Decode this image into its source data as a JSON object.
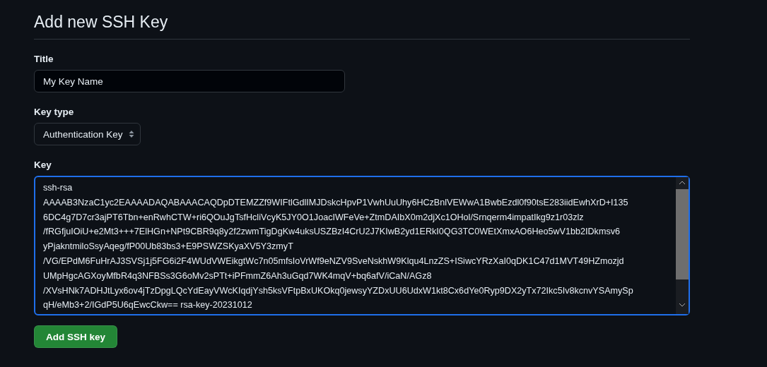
{
  "heading": "Add new SSH Key",
  "title_field": {
    "label": "Title",
    "value": "My Key Name"
  },
  "key_type": {
    "label": "Key type",
    "value": "Authentication Key"
  },
  "key_field": {
    "label": "Key",
    "focused": true,
    "lines": [
      "ssh-rsa",
      "AAAAB3NzaC1yc2EAAAADAQABAAACAQDpDTEMZZf9WIFtlGdlIMJDskcHpvP1VwhUuUhy6HCzBnlVEWwA1BwbEzdl0f90tsE283iidEwhXrD+I135",
      "6DC4g7D7cr3ajPT6Tbn+enRwhCTW+ri6QOuJgTsfHcliVcyK5JY0O1JoacIWFeVe+ZtmDAIbX0m2djXc1OHol/Srnqerm4impatIkg9z1r03zlz",
      "/fRGfjuIOiU+e2Mt3+++7ElHGn+NPt9CBR9q8y2f2zwmTigDgKw4uksUSZBzI4CrU2J7KIwB2yd1ERkI0QG3TC0WEtXmxAO6Heo5wV1bb2IDkmsv6",
      "yPjakntmiloSsyAqeg/fP00Ub83bs3+E9PSWZSKyaXV5Y3zmyT",
      "/VG/EPdM6FuHrAJ3SVSj1j5FG6i2F4WUdVWEikgtWc7n05mfsIoVrWf9eNZV9SveNskhW9Klqu4LnzZS+ISiwcYRzXaI0qDK1C47d1MVT49HZmozjd",
      "UMpHgcAGXoyMfbR4q3NFBSs3G6oMv2sPTt+iPFmmZ6Ah3uGqd7WK4mqV+bq6afV/iCaN/AGz8",
      "/XVsHNk7ADHJtLyx6ov4jTzDpgLQcYdEayVWcKIqdjYsh5ksVFtpBxUKOkq0jewsyYZDxUU6UdxW1kt8Cx6dYe0Ryp9DX2yTx72Ikc5Iv8kcnvYSAmySp",
      "qH/eMb3+2/IGdP5U6qEwcCkw== rsa-key-20231012"
    ]
  },
  "submit_button": "Add SSH key"
}
